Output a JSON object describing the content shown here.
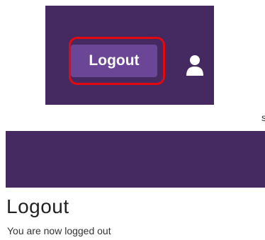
{
  "header": {
    "logout_label": "Logout",
    "user_icon": "user-icon",
    "highlight_color": "#e3090f",
    "background_color": "#452961",
    "button_color": "#6c4696"
  },
  "stray_text": "s",
  "banner": {
    "color": "#452961"
  },
  "main": {
    "title": "Logout",
    "message": "You are now logged out"
  }
}
